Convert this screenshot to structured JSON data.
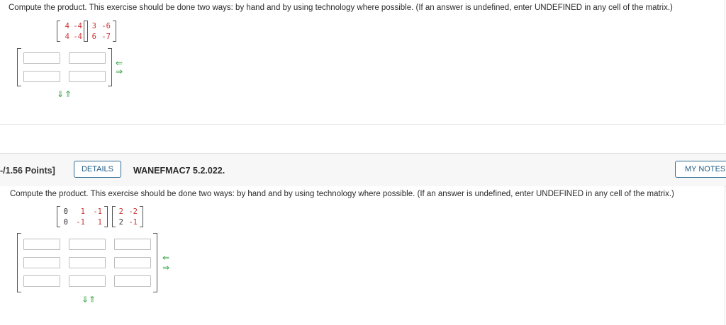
{
  "q1": {
    "prompt": "Compute the product. This exercise should be done two ways: by hand and by using technology where possible. (If an answer is undefined, enter UNDEFINED in any cell of the matrix.)",
    "matrix_a": [
      [
        "4",
        "-4"
      ],
      [
        "4",
        "-4"
      ]
    ],
    "matrix_b": [
      [
        "3",
        "-6"
      ],
      [
        "6",
        "-7"
      ]
    ],
    "answer": [
      [
        "",
        ""
      ],
      [
        "",
        ""
      ]
    ]
  },
  "q2": {
    "points_label": "-/1.56 Points]",
    "details_label": "DETAILS",
    "question_id": "WANEFMAC7 5.2.022.",
    "my_notes_label": "MY NOTES",
    "prompt": "Compute the product. This exercise should be done two ways: by hand and by using technology where possible. (If an answer is undefined, enter UNDEFINED in any cell of the matrix.)",
    "matrix_a": [
      [
        "0",
        "1",
        "-1"
      ],
      [
        "0",
        "-1",
        "1"
      ]
    ],
    "matrix_b": [
      [
        "2",
        "-2"
      ],
      [
        "2",
        "-1"
      ]
    ],
    "answer": [
      [
        "",
        "",
        ""
      ],
      [
        "",
        "",
        ""
      ],
      [
        "",
        "",
        ""
      ]
    ]
  },
  "icons": {
    "left_arrow": "⇐",
    "right_arrow": "⇒",
    "down_arrow": "⇓",
    "up_arrow": "⇑"
  },
  "colors": {
    "accent": "#1e5b83",
    "matrix_red": "#cc3333",
    "arrow_green": "#2e9e3c"
  }
}
